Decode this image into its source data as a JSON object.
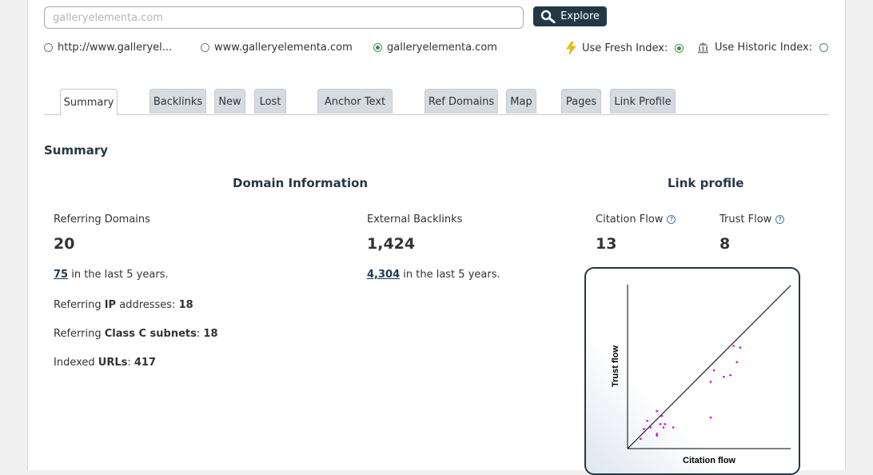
{
  "search": {
    "placeholder": "galleryelementa.com",
    "button_label": "Explore"
  },
  "scope_options": [
    {
      "label": "http://www.galleryel...",
      "selected": false
    },
    {
      "label": "www.galleryelementa.com",
      "selected": false
    },
    {
      "label": "galleryelementa.com",
      "selected": true
    }
  ],
  "index_options": {
    "fresh_label": "Use Fresh Index:",
    "fresh_selected": true,
    "historic_label": "Use Historic Index:",
    "historic_selected": false
  },
  "tabs": [
    "Summary",
    "Backlinks",
    "New",
    "Lost",
    "Anchor Text",
    "Ref Domains",
    "Map",
    "Pages",
    "Link Profile"
  ],
  "active_tab": "Summary",
  "summary_heading": "Summary",
  "domain_info": {
    "title": "Domain Information",
    "ref_domains_label": "Referring Domains",
    "ref_domains_value": "20",
    "ref_domains_history_value": "75",
    "ref_domains_history_text": " in the last 5 years.",
    "ext_backlinks_label": "External Backlinks",
    "ext_backlinks_value": "1,424",
    "ext_backlinks_history_value": "4,304",
    "ext_backlinks_history_text": " in the last 5 years.",
    "ref_ip_prefix": "Referring ",
    "ref_ip_bold": "IP",
    "ref_ip_suffix": " addresses: ",
    "ref_ip_value": "18",
    "class_c_prefix": "Referring ",
    "class_c_bold": "Class C subnets",
    "class_c_suffix": ": ",
    "class_c_value": "18",
    "indexed_prefix": "Indexed ",
    "indexed_bold": "URLs",
    "indexed_suffix": ": ",
    "indexed_value": "417"
  },
  "link_profile": {
    "title": "Link profile",
    "citation_flow_label": "Citation Flow",
    "citation_flow_value": "13",
    "trust_flow_label": "Trust Flow",
    "trust_flow_value": "8"
  },
  "chart_data": {
    "type": "scatter",
    "ylabel": "Trust flow",
    "xlabel": "Citation flow",
    "xlim": [
      0,
      100
    ],
    "ylim": [
      0,
      100
    ],
    "reference_line": "diagonal y = x",
    "point_color": "#e000e0",
    "points": [
      {
        "x": 8,
        "y": 6
      },
      {
        "x": 10,
        "y": 12
      },
      {
        "x": 12,
        "y": 17
      },
      {
        "x": 14,
        "y": 13
      },
      {
        "x": 18,
        "y": 8
      },
      {
        "x": 18,
        "y": 9
      },
      {
        "x": 18,
        "y": 23
      },
      {
        "x": 20,
        "y": 15
      },
      {
        "x": 21,
        "y": 20
      },
      {
        "x": 22,
        "y": 13
      },
      {
        "x": 23,
        "y": 15
      },
      {
        "x": 28,
        "y": 13
      },
      {
        "x": 51,
        "y": 19
      },
      {
        "x": 51,
        "y": 41
      },
      {
        "x": 53,
        "y": 48
      },
      {
        "x": 59,
        "y": 44
      },
      {
        "x": 63,
        "y": 45
      },
      {
        "x": 67,
        "y": 53
      },
      {
        "x": 65,
        "y": 63
      },
      {
        "x": 69,
        "y": 62
      }
    ]
  }
}
